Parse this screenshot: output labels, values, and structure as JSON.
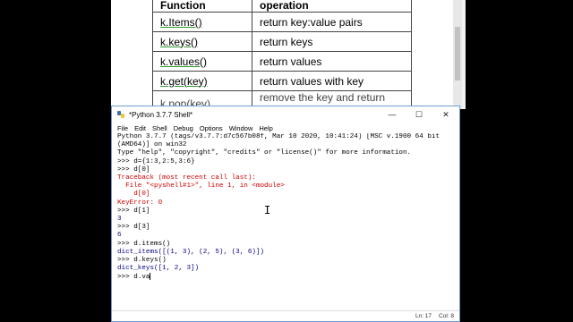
{
  "doc_table": {
    "header": {
      "function": "Function",
      "operation": "operation"
    },
    "rows": [
      {
        "fn": "k.Items()",
        "op": "return key:value pairs"
      },
      {
        "fn": "k.keys()",
        "op": "return keys"
      },
      {
        "fn": "k.values()",
        "op": "return values"
      },
      {
        "fn": "k.get(key)",
        "op": "return values with key"
      },
      {
        "fn": "k.pop(key)",
        "op": "remove the key and return value"
      }
    ]
  },
  "window": {
    "title": "*Python 3.7.7 Shell*",
    "controls": {
      "minimize": "—",
      "maximize": "☐",
      "close": "✕"
    }
  },
  "menu": [
    "File",
    "Edit",
    "Shell",
    "Debug",
    "Options",
    "Window",
    "Help"
  ],
  "shell_lines": [
    {
      "text": "Python 3.7.7 (tags/v3.7.7:d7c567b08f, Mar 10 2020, 10:41:24) [MSC v.1900 64 bit",
      "kind": "plain"
    },
    {
      "text": "(AMD64)] on win32",
      "kind": "plain"
    },
    {
      "text": "Type \"help\", \"copyright\", \"credits\" or \"license()\" for more information.",
      "kind": "plain"
    },
    {
      "text": ">>> d={1:3,2:5,3:6}",
      "kind": "prompt"
    },
    {
      "text": ">>> d[0]",
      "kind": "prompt"
    },
    {
      "text": "Traceback (most recent call last):",
      "kind": "err"
    },
    {
      "text": "  File \"<pyshell#1>\", line 1, in <module>",
      "kind": "err"
    },
    {
      "text": "    d[0]",
      "kind": "err"
    },
    {
      "text": "KeyError: 0",
      "kind": "err"
    },
    {
      "text": ">>> d[1]",
      "kind": "prompt"
    },
    {
      "text": "3",
      "kind": "out"
    },
    {
      "text": ">>> d[3]",
      "kind": "prompt"
    },
    {
      "text": "6",
      "kind": "out"
    },
    {
      "text": ">>> d.items()",
      "kind": "prompt"
    },
    {
      "text": "dict_items([(1, 3), (2, 5), (3, 6)])",
      "kind": "out"
    },
    {
      "text": ">>> d.keys()",
      "kind": "prompt"
    },
    {
      "text": "dict_keys([1, 2, 3])",
      "kind": "out"
    },
    {
      "text": ">>> d.va",
      "kind": "prompt"
    }
  ],
  "status": {
    "line": "Ln: 17",
    "col": "Col: 8"
  }
}
